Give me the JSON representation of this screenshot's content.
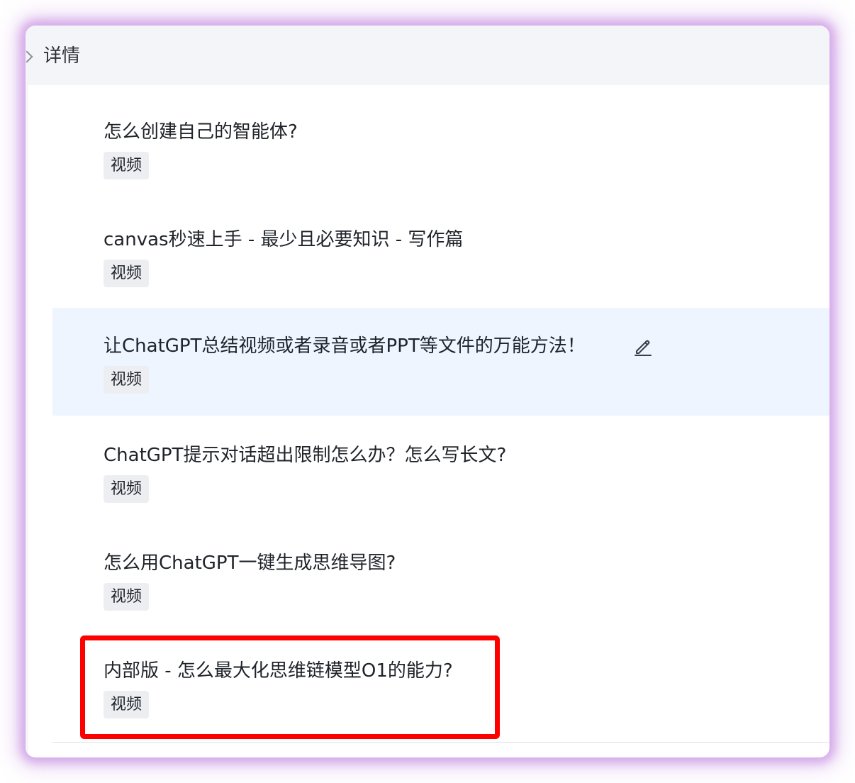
{
  "header": {
    "title": "详情"
  },
  "items": [
    {
      "title": "怎么创建自己的智能体?",
      "tag": "视频"
    },
    {
      "title": "canvas秒速上手 - 最少且必要知识 - 写作篇",
      "tag": "视频"
    },
    {
      "title": "让ChatGPT总结视频或者录音或者PPT等文件的万能方法！",
      "tag": "视频"
    },
    {
      "title": "ChatGPT提示对话超出限制怎么办？怎么写长文?",
      "tag": "视频"
    },
    {
      "title": "怎么用ChatGPT一键生成思维导图?",
      "tag": "视频"
    },
    {
      "title": "内部版 - 怎么最大化思维链模型O1的能力?",
      "tag": "视频"
    }
  ],
  "icons": {
    "header_toggle": "chevron-right-icon",
    "row_action": "pencil-edit-icon"
  },
  "colors": {
    "hover_row": "#eef5ff",
    "highlight_border": "#ff0000",
    "tag_background": "#eceef1"
  }
}
